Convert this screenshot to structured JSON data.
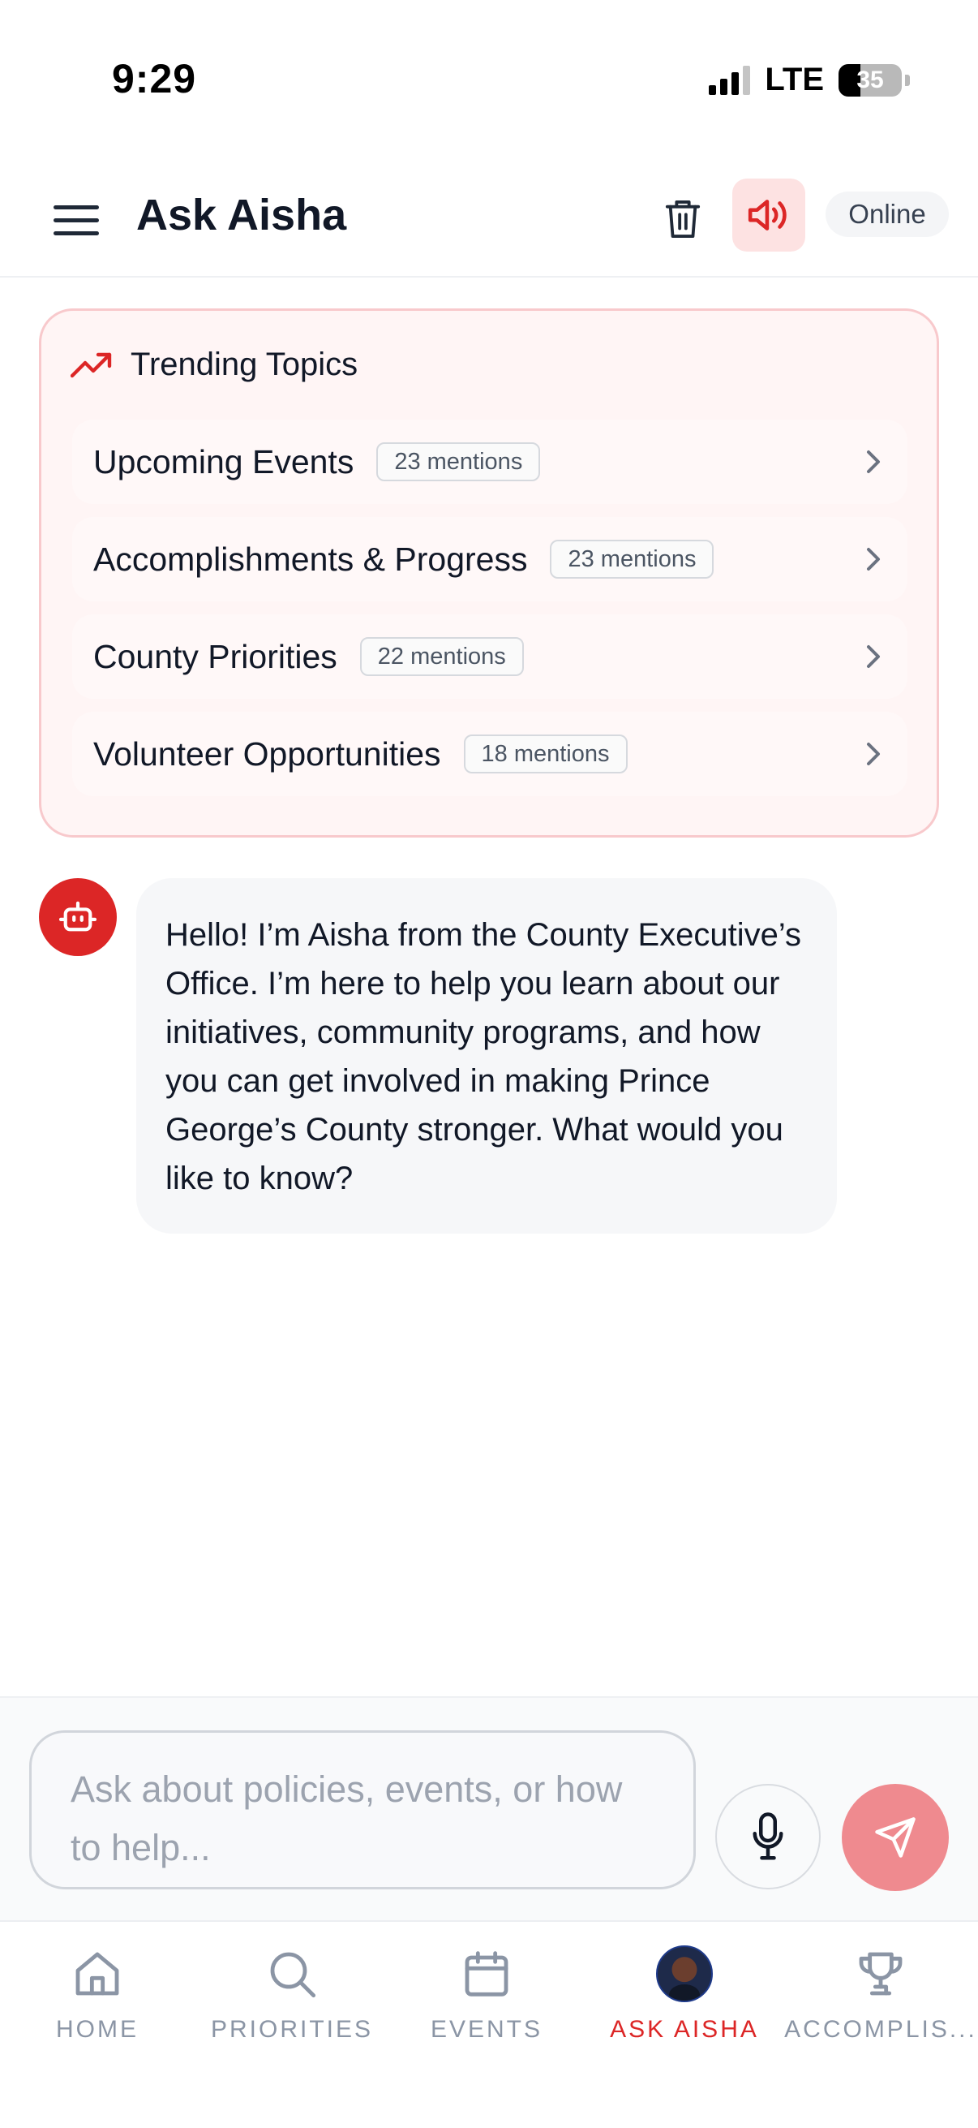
{
  "status_bar": {
    "time": "9:29",
    "network": "LTE",
    "battery_level": "35"
  },
  "header": {
    "title": "Ask Aisha",
    "status": "Online",
    "icons": [
      "menu-icon",
      "trash-icon",
      "speaker-icon"
    ]
  },
  "trending": {
    "title": "Trending Topics",
    "topics": [
      {
        "label": "Upcoming Events",
        "mentions": "23 mentions"
      },
      {
        "label": "Accomplishments & Progress",
        "mentions": "23 mentions"
      },
      {
        "label": "County Priorities",
        "mentions": "22 mentions"
      },
      {
        "label": "Volunteer Opportunities",
        "mentions": "18 mentions"
      }
    ]
  },
  "chat": {
    "messages": [
      {
        "sender": "bot",
        "text": "Hello! I’m Aisha from the County Executive’s Office. I’m here to help you learn about our initiatives, community programs, and how you can get involved in making Prince George’s County stronger. What would you like to know?"
      }
    ]
  },
  "composer": {
    "placeholder": "Ask about policies, events, or how to help..."
  },
  "nav": {
    "items": [
      {
        "label": "HOME",
        "icon": "home-icon"
      },
      {
        "label": "PRIORITIES",
        "icon": "search-icon"
      },
      {
        "label": "EVENTS",
        "icon": "calendar-icon"
      },
      {
        "label": "ASK AISHA",
        "icon": "avatar"
      },
      {
        "label": "ACCOMPLIS...",
        "icon": "trophy-icon"
      }
    ],
    "active": "ASK AISHA"
  },
  "colors": {
    "accent": "#dc2626",
    "send_button": "#ef8a8f",
    "card_border": "#f8c9cc",
    "card_background": "#fff5f5"
  }
}
